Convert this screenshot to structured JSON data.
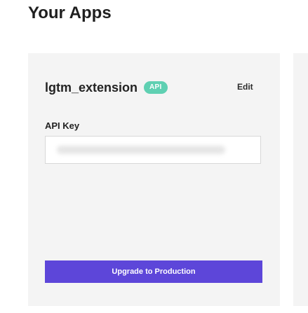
{
  "page": {
    "title": "Your Apps"
  },
  "app": {
    "name": "lgtm_extension",
    "badge": "API",
    "edit_label": "Edit",
    "api_key_label": "API Key",
    "upgrade_label": "Upgrade to Production"
  },
  "colors": {
    "badge_background": "#5fd0b2",
    "button_background": "#5d46d9",
    "card_background": "#f4f4f4"
  }
}
